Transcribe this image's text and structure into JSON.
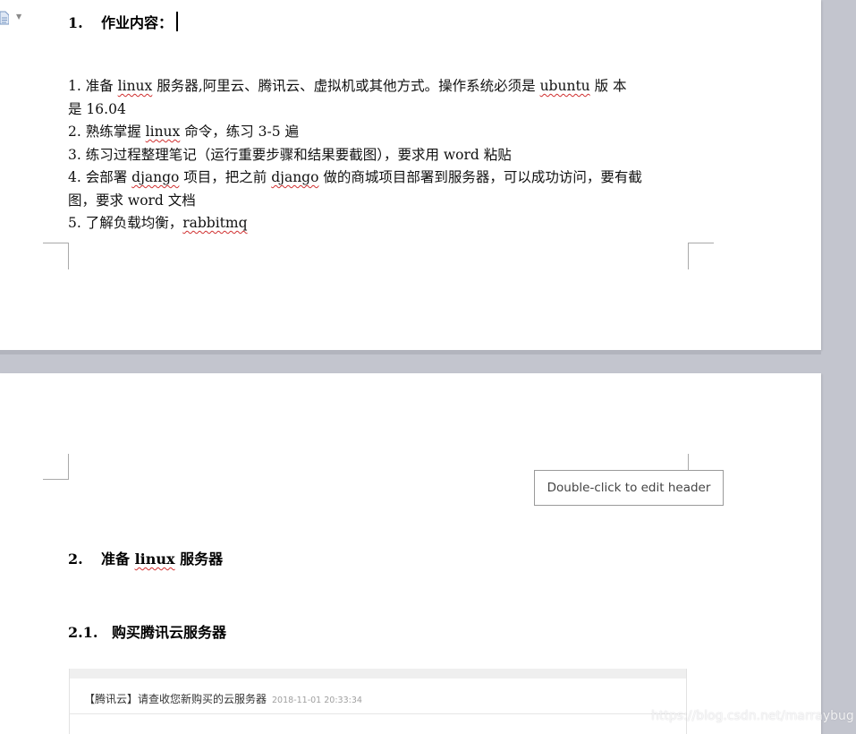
{
  "page1": {
    "heading": {
      "number": "1.",
      "text": "作业内容："
    },
    "items": [
      {
        "parts": [
          {
            "t": "1.  准备 "
          },
          {
            "t": "linux",
            "sq": true
          },
          {
            "t": "  服务器,阿里云、腾讯云、虚拟机或其他方式。操作系统必须是 "
          },
          {
            "t": "ubuntu",
            "sq": true
          },
          {
            "t": "  版  本"
          }
        ]
      },
      {
        "parts": [
          {
            "t": "是 16.04"
          }
        ]
      },
      {
        "parts": [
          {
            "t": "2.  熟练掌握 "
          },
          {
            "t": "linux",
            "sq": true
          },
          {
            "t": "  命令，练习 3-5 遍"
          }
        ]
      },
      {
        "parts": [
          {
            "t": "3.  练习过程整理笔记（运行重要步骤和结果要截图），要求用 word 粘贴"
          }
        ]
      },
      {
        "parts": [
          {
            "t": "4.  会部署 "
          },
          {
            "t": "django",
            "sq": true
          },
          {
            "t": "  项目，把之前 "
          },
          {
            "t": "django",
            "sq": true
          },
          {
            "t": " 做的商城项目部署到服务器，可以成功访问，要有截"
          }
        ]
      },
      {
        "parts": [
          {
            "t": "图，要求 word 文档"
          }
        ]
      },
      {
        "parts": [
          {
            "t": "5.  了解负载均衡，"
          },
          {
            "t": "rabbitmq",
            "sq": true
          }
        ]
      }
    ]
  },
  "page2": {
    "header_tip": "Double-click to edit header",
    "heading2": {
      "number": "2.",
      "pre": "准备 ",
      "sq": "linux",
      "post": " 服务器"
    },
    "heading21": {
      "number": "2.1.",
      "text": "购买腾讯云服务器"
    },
    "email": {
      "subject": "【腾讯云】请查收您新购买的云服务器",
      "date": "2018-11-01 20:33:34"
    }
  },
  "watermark": "https://blog.csdn.net/marraybug",
  "icons": {
    "doc": "document-icon",
    "caret": "chevron-down-icon"
  },
  "colors": {
    "spellcheck": "#d03030",
    "workspace": "#c3c5ce"
  }
}
